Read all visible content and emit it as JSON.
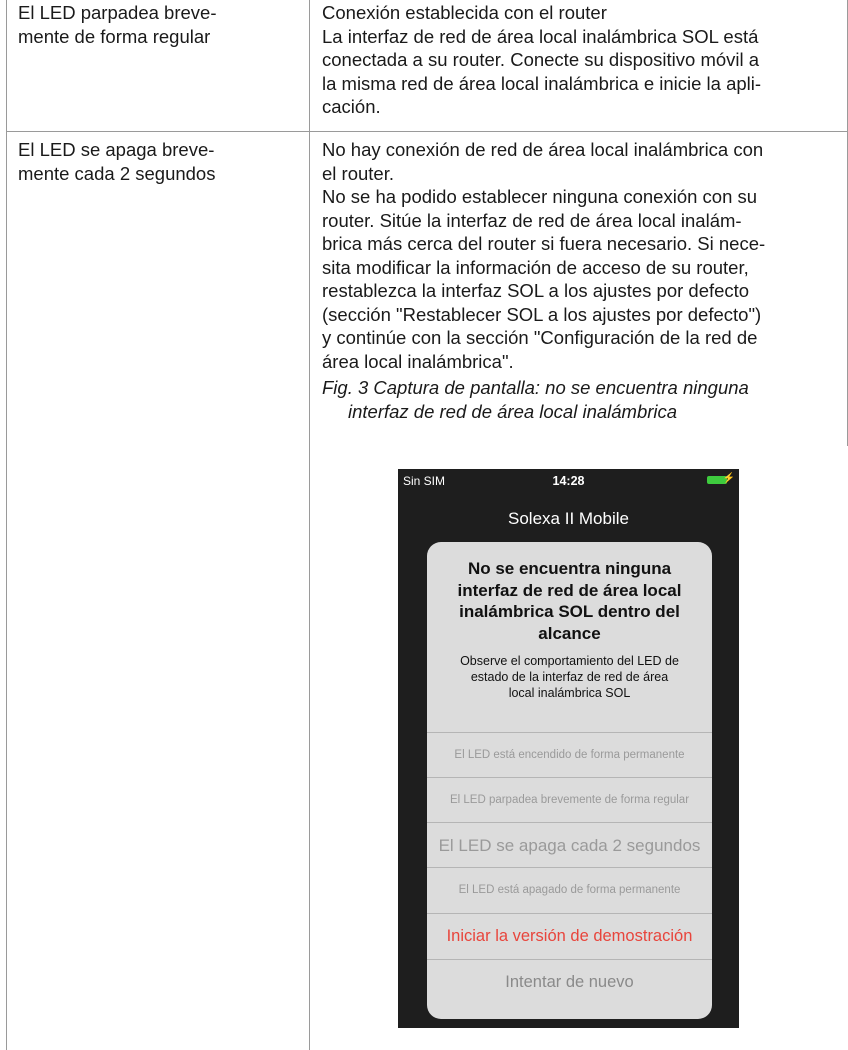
{
  "rows": [
    {
      "state_lines": [
        "El LED parpadea breve-",
        "mente de forma regular"
      ],
      "meaning_lines": [
        "Conexión establecida con el router",
        "La interfaz de red de área local inalámbrica SOL está",
        "conectada a su router. Conecte su dispositivo móvil a",
        "la misma red de área local inalámbrica e inicie la apli-",
        "cación."
      ]
    },
    {
      "state_lines": [
        "El LED se apaga breve-",
        "mente cada 2 segundos"
      ],
      "meaning_lines": [
        "No hay conexión de red de área local inalámbrica con",
        "el router.",
        "No se ha podido establecer ninguna conexión con su",
        "router. Sitúe la interfaz de red de área local inalám-",
        "brica más cerca del router si fuera necesario. Si nece-",
        "sita modificar la información de acceso de su router,",
        "restablezca la interfaz SOL a los ajustes por defecto",
        "(sección \"Restablecer SOL a los ajustes por defecto\")",
        "y continúe con la sección \"Configuración de la red de",
        "área local inalámbrica\"."
      ],
      "caption_lines": [
        "Fig. 3  Captura de pantalla: no se encuentra ninguna",
        "interfaz de red de área local inalámbrica"
      ]
    }
  ],
  "phone": {
    "status": {
      "carrier": "Sin SIM",
      "time": "14:28"
    },
    "app_title": "Solexa II Mobile",
    "alert": {
      "title_lines": [
        "No se encuentra ninguna",
        "interfaz de red de área local",
        "inalámbrica SOL dentro del",
        "alcance"
      ],
      "message_lines": [
        "Observe el comportamiento del LED de",
        "estado de la interfaz de red de área",
        "local inalámbrica SOL"
      ],
      "buttons": [
        "El LED está encendido de forma permanente",
        "El LED parpadea brevemente de forma regular",
        "El LED se apaga cada 2 segundos",
        "El LED está apagado de forma permanente",
        "Iniciar la versión de demostración",
        "Intentar de nuevo"
      ]
    },
    "colors": {
      "battery": "#3ecb3e",
      "demo_button": "#e8453c"
    }
  }
}
